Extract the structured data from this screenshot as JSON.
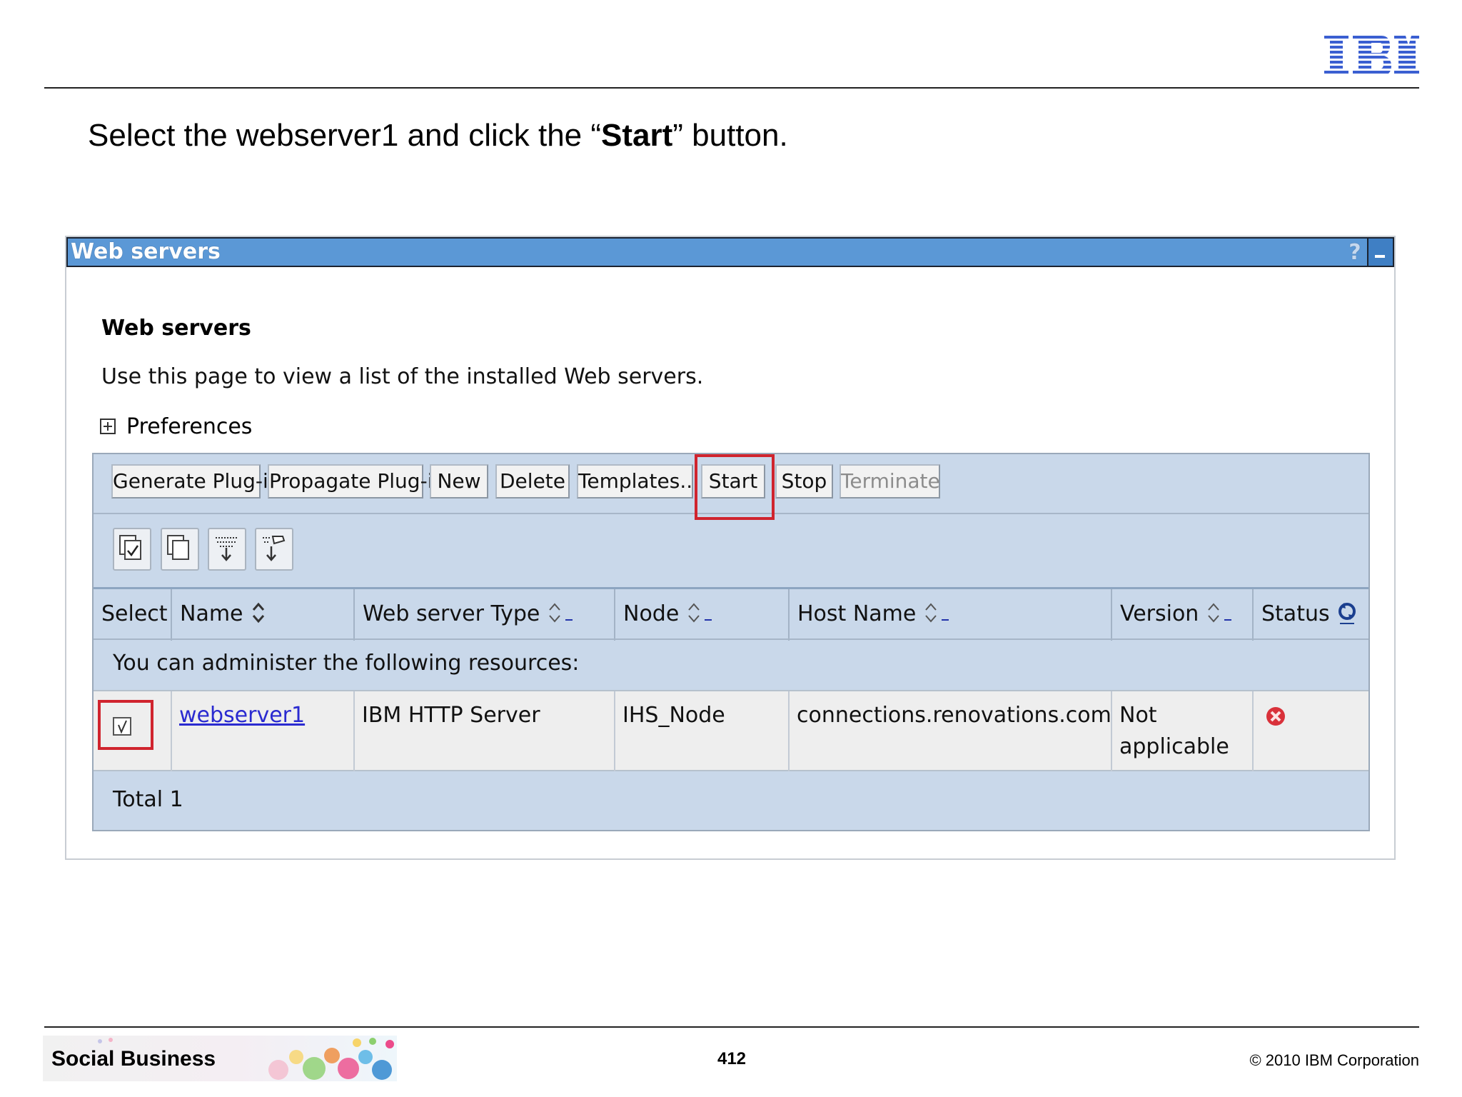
{
  "slide": {
    "logo_text": "IBM",
    "instruction_before": "Select the webserver1 and click the “",
    "instruction_bold": "Start",
    "instruction_after": "” button.",
    "page_number": "412",
    "copyright": "© 2010 IBM Corporation",
    "footer_banner_label": "Social Business"
  },
  "portlet": {
    "title": "Web servers",
    "help_glyph": "?",
    "heading": "Web servers",
    "description": "Use this page to view a list of the installed Web servers.",
    "preferences_label": "Preferences"
  },
  "toolbar": {
    "buttons": [
      {
        "label": "Generate Plug-in",
        "enabled": true
      },
      {
        "label": "Propagate Plug-in",
        "enabled": true
      },
      {
        "label": "New",
        "enabled": true
      },
      {
        "label": "Delete",
        "enabled": true
      },
      {
        "label": "Templates...",
        "enabled": true
      },
      {
        "label": "Start",
        "enabled": true,
        "highlighted": true
      },
      {
        "label": "Stop",
        "enabled": true
      },
      {
        "label": "Terminate",
        "enabled": false
      }
    ],
    "icons": [
      "select-all-icon",
      "deselect-all-icon",
      "show-filter-icon",
      "clear-filter-icon"
    ]
  },
  "table": {
    "columns": [
      "Select",
      "Name",
      "Web server Type",
      "Node",
      "Host Name",
      "Version",
      "Status"
    ],
    "info_text": "You can administer the following resources:",
    "rows": [
      {
        "selected": true,
        "name": "webserver1",
        "type": "IBM HTTP Server",
        "node": "IHS_Node",
        "host": "connections.renovations.com",
        "version_line1": "Not",
        "version_line2": "applicable",
        "status": "stopped-icon"
      }
    ],
    "total_text": "Total 1"
  },
  "colors": {
    "title_bar": "#5b98d6",
    "table_bg": "#c9d8ea",
    "highlight": "#d0242e",
    "link": "#2a2ad0",
    "status_stopped": "#d9313a"
  }
}
